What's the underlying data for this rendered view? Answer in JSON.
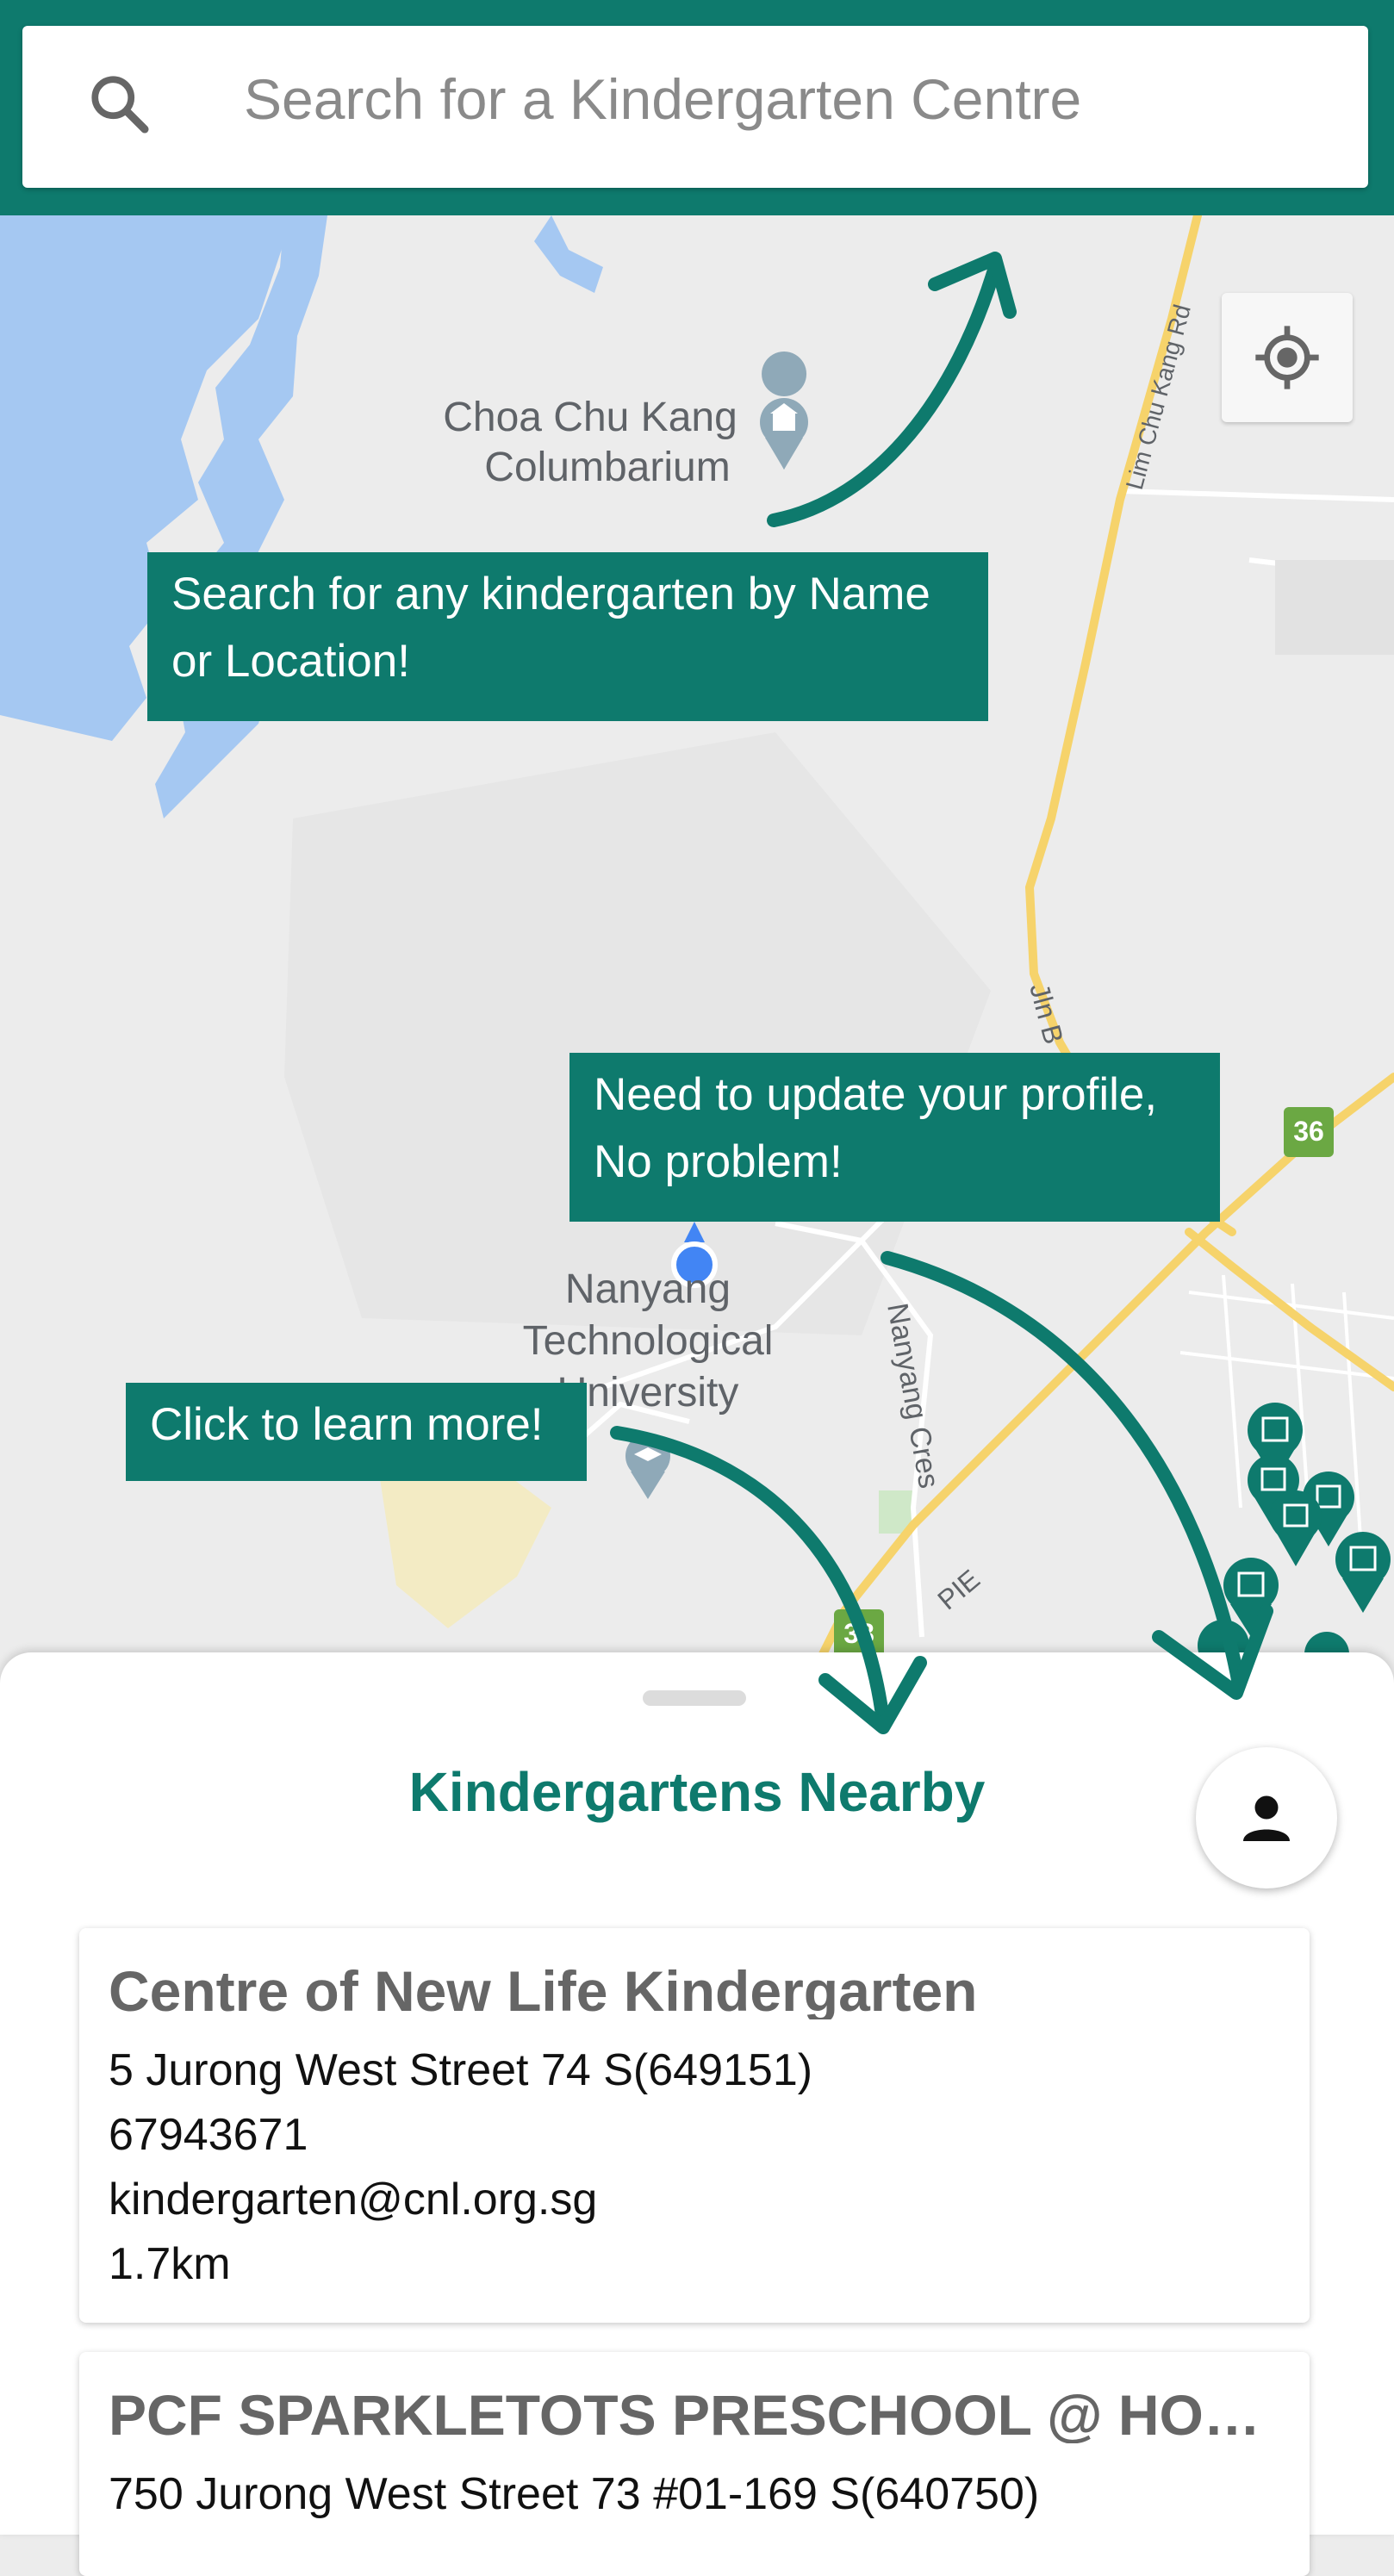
{
  "search": {
    "placeholder": "Search for a Kindergarten Centre",
    "icon": "search-icon"
  },
  "map": {
    "labels": {
      "columbarium_line1": "Choa Chu Kang",
      "columbarium_line2": "Columbarium",
      "ntu_line1": "Nanyang",
      "ntu_line2": "Technological",
      "ntu_line3": "University",
      "road_lim_chu_kang": "Lim Chu Kang Rd",
      "road_jln": "Jln B",
      "road_nanyang_cres": "Nanyang Cres",
      "road_pie": "PIE",
      "exit_36": "36",
      "exit_38": "38"
    },
    "locate_icon": "my-location-icon"
  },
  "tutorial": {
    "search_tip": [
      "Search for any kindergarten by Name",
      "or Location!"
    ],
    "profile_tip": [
      "Need to update your profile,",
      "No problem!"
    ],
    "learn_tip": "Click to learn more!"
  },
  "sheet": {
    "title": "Kindergartens Nearby",
    "profile_icon": "person-icon"
  },
  "kindergartens": [
    {
      "name": "Centre of New Life Kindergarten",
      "address": "5 Jurong West Street 74 S(649151)",
      "phone": "67943671",
      "email": "kindergarten@cnl.org.sg",
      "distance": "1.7km"
    },
    {
      "name": "PCF SPARKLETOTS PRESCHOOL @ HON...",
      "address": "750 Jurong West Street 73 #01-169 S(640750)"
    }
  ],
  "colors": {
    "primary": "#0e7a6d",
    "map_water": "#a5c8f2",
    "map_land": "#ececec",
    "road_major": "#f6d36b",
    "user_location": "#4285f4"
  }
}
